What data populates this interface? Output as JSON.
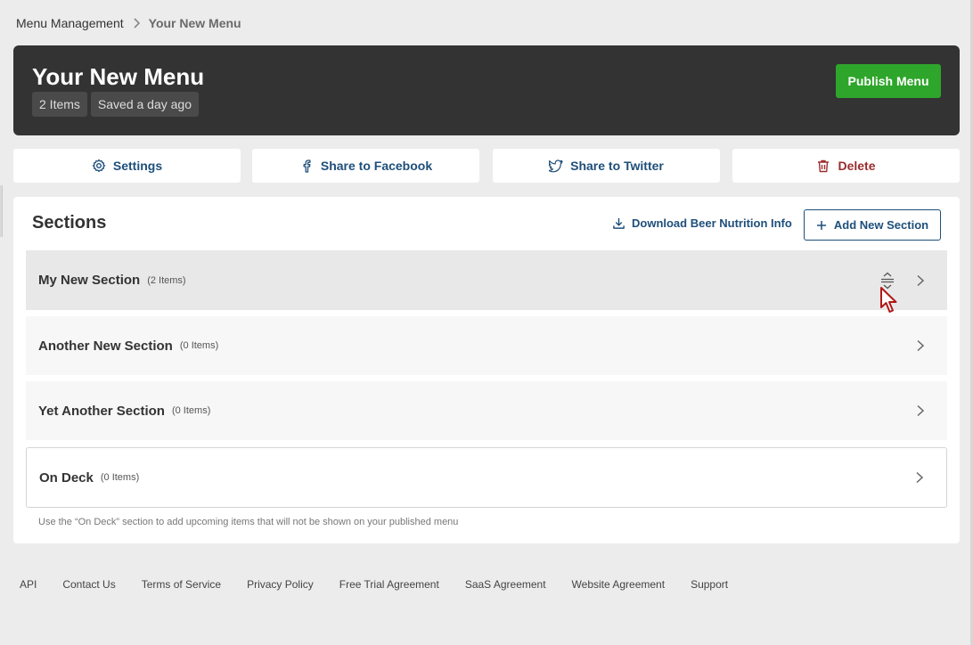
{
  "breadcrumb": {
    "parent": "Menu Management",
    "current": "Your New Menu"
  },
  "header": {
    "title": "Your New Menu",
    "items_badge": "2 Items",
    "saved_badge": "Saved a day ago",
    "publish_label": "Publish Menu"
  },
  "actions": {
    "settings": "Settings",
    "facebook": "Share to Facebook",
    "twitter": "Share to Twitter",
    "delete": "Delete"
  },
  "sections_panel": {
    "title": "Sections",
    "download_label": "Download Beer Nutrition Info",
    "add_label": "Add New Section",
    "hint": "Use the “On Deck” section to add upcoming items that will not be shown on your published menu",
    "sections": [
      {
        "name": "My New Section",
        "count": "(2 Items)"
      },
      {
        "name": "Another New Section",
        "count": "(0 Items)"
      },
      {
        "name": "Yet Another Section",
        "count": "(0 Items)"
      },
      {
        "name": "On Deck",
        "count": "(0 Items)"
      }
    ]
  },
  "footer": {
    "links": [
      "API",
      "Contact Us",
      "Terms of Service",
      "Privacy Policy",
      "Free Trial Agreement",
      "SaaS Agreement",
      "Website Agreement",
      "Support"
    ]
  },
  "colors": {
    "header_bg": "#333333",
    "publish_green": "#2ea52b",
    "link_blue": "#1e4f7a",
    "delete_red": "#9b2d2d"
  },
  "icons": [
    "chevron-right-icon",
    "gear-icon",
    "facebook-icon",
    "twitter-icon",
    "trash-icon",
    "download-icon",
    "plus-icon",
    "drag-handle-icon",
    "cursor-icon"
  ]
}
